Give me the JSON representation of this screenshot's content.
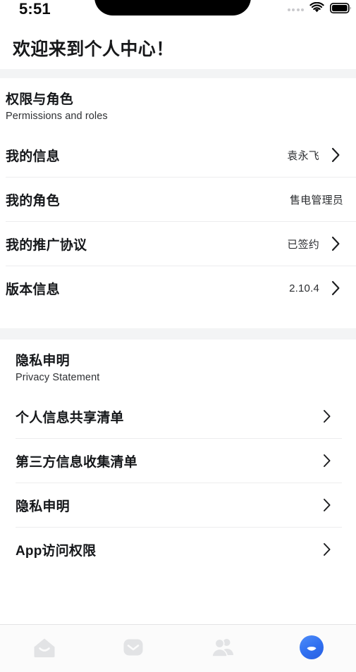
{
  "status_bar": {
    "time": "5:51",
    "signal_icon": "signal-dots-icon",
    "wifi_icon": "wifi-icon",
    "battery_icon": "battery-full-icon"
  },
  "header": {
    "title": "欢迎来到个人中心！"
  },
  "sections": [
    {
      "title": "权限与角色",
      "subtitle": "Permissions and roles",
      "rows": [
        {
          "label": "我的信息",
          "value": "袁永飞",
          "chevron": true
        },
        {
          "label": "我的角色",
          "value": "售电管理员",
          "chevron": false
        },
        {
          "label": "我的推广协议",
          "value": "已签约",
          "chevron": true
        },
        {
          "label": "版本信息",
          "value": "2.10.4",
          "chevron": true
        }
      ]
    },
    {
      "title": "隐私申明",
      "subtitle": "Privacy Statement",
      "rows": [
        {
          "label": "个人信息共享清单",
          "value": "",
          "chevron": true
        },
        {
          "label": "第三方信息收集清单",
          "value": "",
          "chevron": true
        },
        {
          "label": "隐私申明",
          "value": "",
          "chevron": true
        },
        {
          "label": "App访问权限",
          "value": "",
          "chevron": true
        }
      ]
    }
  ],
  "tabbar": {
    "items": [
      {
        "icon": "home-icon",
        "active": false
      },
      {
        "icon": "message-icon",
        "active": false
      },
      {
        "icon": "contacts-icon",
        "active": false
      },
      {
        "icon": "profile-icon",
        "active": true
      }
    ],
    "active_color": "#2f6ff0",
    "inactive_color": "#e2e3e5"
  }
}
